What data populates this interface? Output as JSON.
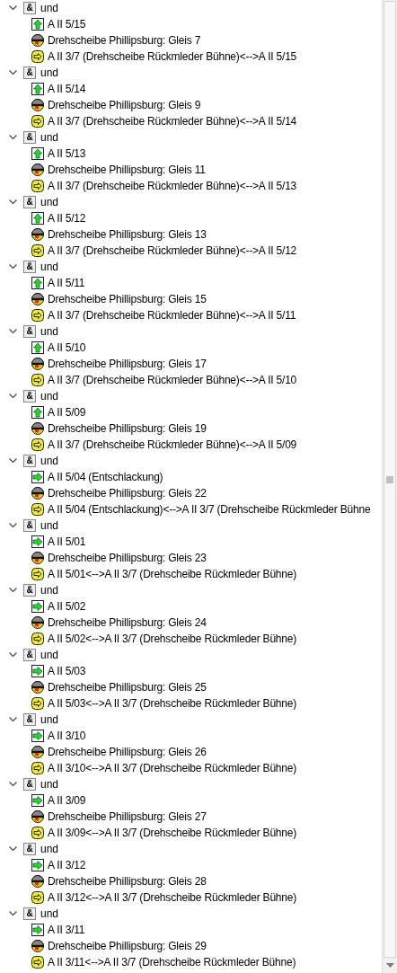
{
  "tree": [
    {
      "label": "und",
      "symbol": "&",
      "expanded": true,
      "children": [
        {
          "kind": "signal_up",
          "text": "A II 5/15"
        },
        {
          "kind": "turntable",
          "text": "Drehscheibe Phillipsburg: Gleis 7"
        },
        {
          "kind": "route",
          "text": "A II 3/7 (Drehscheibe Rückmleder Bühne)<-->A II 5/15"
        }
      ]
    },
    {
      "label": "und",
      "symbol": "&",
      "expanded": true,
      "children": [
        {
          "kind": "signal_up",
          "text": "A II 5/14"
        },
        {
          "kind": "turntable",
          "text": "Drehscheibe Phillipsburg: Gleis 9"
        },
        {
          "kind": "route",
          "text": "A II 3/7 (Drehscheibe Rückmleder Bühne)<-->A II 5/14"
        }
      ]
    },
    {
      "label": "und",
      "symbol": "&",
      "expanded": true,
      "children": [
        {
          "kind": "signal_up",
          "text": "A II 5/13"
        },
        {
          "kind": "turntable",
          "text": "Drehscheibe Phillipsburg: Gleis 11"
        },
        {
          "kind": "route",
          "text": "A II 3/7 (Drehscheibe Rückmleder Bühne)<-->A II 5/13"
        }
      ]
    },
    {
      "label": "und",
      "symbol": "&",
      "expanded": true,
      "children": [
        {
          "kind": "signal_up",
          "text": "A II 5/12"
        },
        {
          "kind": "turntable",
          "text": "Drehscheibe Phillipsburg: Gleis 13"
        },
        {
          "kind": "route",
          "text": "A II 3/7 (Drehscheibe Rückmleder Bühne)<-->A II 5/12"
        }
      ]
    },
    {
      "label": "und",
      "symbol": "&",
      "expanded": true,
      "children": [
        {
          "kind": "signal_up",
          "text": "A II 5/11"
        },
        {
          "kind": "turntable",
          "text": "Drehscheibe Phillipsburg: Gleis 15"
        },
        {
          "kind": "route",
          "text": "A II 3/7 (Drehscheibe Rückmleder Bühne)<-->A II 5/11"
        }
      ]
    },
    {
      "label": "und",
      "symbol": "&",
      "expanded": true,
      "children": [
        {
          "kind": "signal_up",
          "text": "A II 5/10"
        },
        {
          "kind": "turntable",
          "text": "Drehscheibe Phillipsburg: Gleis 17"
        },
        {
          "kind": "route",
          "text": "A II 3/7 (Drehscheibe Rückmleder Bühne)<-->A II 5/10"
        }
      ]
    },
    {
      "label": "und",
      "symbol": "&",
      "expanded": true,
      "children": [
        {
          "kind": "signal_up",
          "text": "A II 5/09"
        },
        {
          "kind": "turntable",
          "text": "Drehscheibe Phillipsburg: Gleis 19"
        },
        {
          "kind": "route",
          "text": "A II 3/7 (Drehscheibe Rückmleder Bühne)<-->A II 5/09"
        }
      ]
    },
    {
      "label": "und",
      "symbol": "&",
      "expanded": true,
      "children": [
        {
          "kind": "signal_right",
          "text": "A II 5/04 (Entschlackung)"
        },
        {
          "kind": "turntable",
          "text": "Drehscheibe Phillipsburg: Gleis 22"
        },
        {
          "kind": "route",
          "text": "A II 5/04 (Entschlackung)<-->A II 3/7 (Drehscheibe Rückmleder Bühne"
        }
      ]
    },
    {
      "label": "und",
      "symbol": "&",
      "expanded": true,
      "children": [
        {
          "kind": "signal_right",
          "text": "A II 5/01"
        },
        {
          "kind": "turntable",
          "text": "Drehscheibe Phillipsburg: Gleis 23"
        },
        {
          "kind": "route",
          "text": "A II 5/01<-->A II 3/7 (Drehscheibe Rückmleder Bühne)"
        }
      ]
    },
    {
      "label": "und",
      "symbol": "&",
      "expanded": true,
      "children": [
        {
          "kind": "signal_right",
          "text": "A II 5/02"
        },
        {
          "kind": "turntable",
          "text": "Drehscheibe Phillipsburg: Gleis 24"
        },
        {
          "kind": "route",
          "text": "A II 5/02<-->A II 3/7 (Drehscheibe Rückmleder Bühne)"
        }
      ]
    },
    {
      "label": "und",
      "symbol": "&",
      "expanded": true,
      "children": [
        {
          "kind": "signal_right",
          "text": "A II 5/03"
        },
        {
          "kind": "turntable",
          "text": "Drehscheibe Phillipsburg: Gleis 25"
        },
        {
          "kind": "route",
          "text": "A II 5/03<-->A II 3/7 (Drehscheibe Rückmleder Bühne)"
        }
      ]
    },
    {
      "label": "und",
      "symbol": "&",
      "expanded": true,
      "children": [
        {
          "kind": "signal_right",
          "text": "A II 3/10"
        },
        {
          "kind": "turntable",
          "text": "Drehscheibe Phillipsburg: Gleis 26"
        },
        {
          "kind": "route",
          "text": "A II 3/10<-->A II 3/7 (Drehscheibe Rückmleder Bühne)"
        }
      ]
    },
    {
      "label": "und",
      "symbol": "&",
      "expanded": true,
      "children": [
        {
          "kind": "signal_right",
          "text": "A II 3/09"
        },
        {
          "kind": "turntable",
          "text": "Drehscheibe Phillipsburg: Gleis 27"
        },
        {
          "kind": "route",
          "text": "A II 3/09<-->A II 3/7 (Drehscheibe Rückmleder Bühne)"
        }
      ]
    },
    {
      "label": "und",
      "symbol": "&",
      "expanded": true,
      "children": [
        {
          "kind": "signal_right",
          "text": "A II 3/12"
        },
        {
          "kind": "turntable",
          "text": "Drehscheibe Phillipsburg: Gleis 28"
        },
        {
          "kind": "route",
          "text": "A II 3/12<-->A II 3/7 (Drehscheibe Rückmleder Bühne)"
        }
      ]
    },
    {
      "label": "und",
      "symbol": "&",
      "expanded": true,
      "children": [
        {
          "kind": "signal_right",
          "text": "A II 3/11"
        },
        {
          "kind": "turntable",
          "text": "Drehscheibe Phillipsburg: Gleis 29"
        },
        {
          "kind": "route",
          "text": "A II 3/11<-->A II 3/7 (Drehscheibe Rückmleder Bühne)"
        }
      ]
    }
  ]
}
